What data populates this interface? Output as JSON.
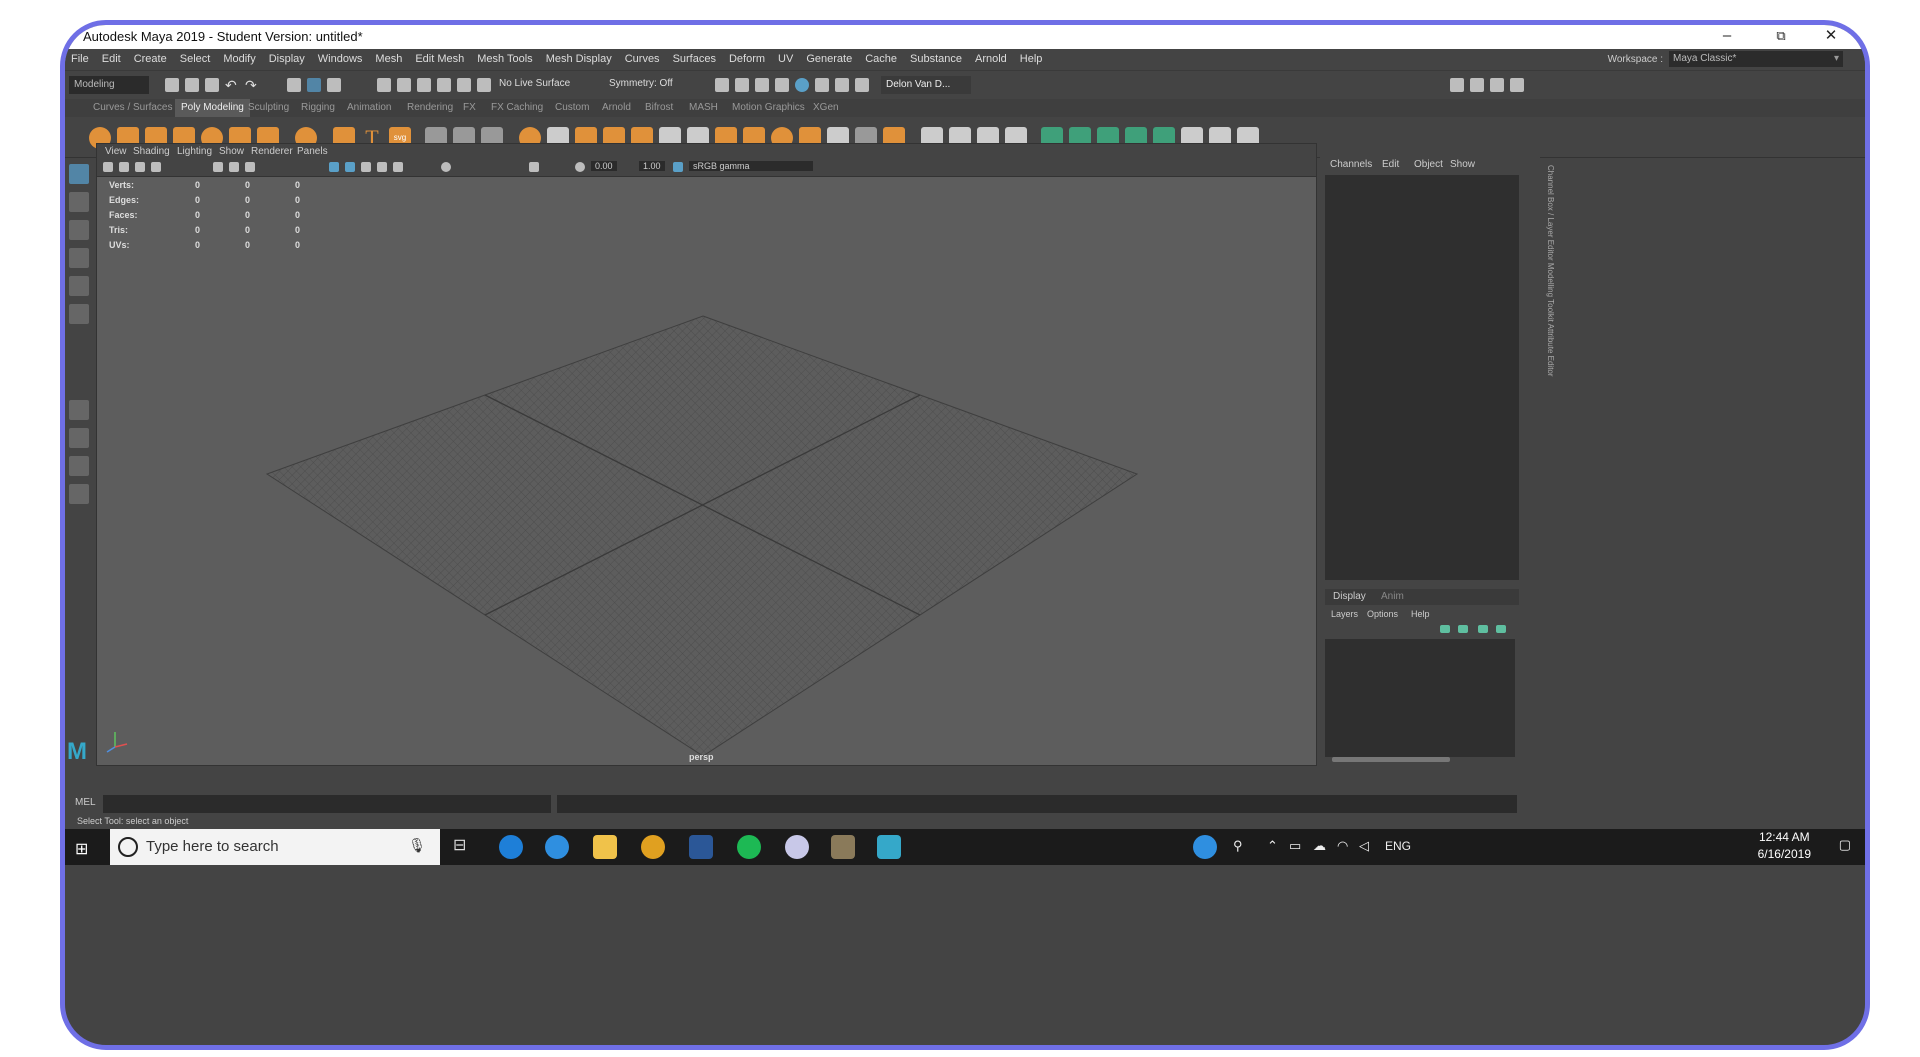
{
  "window": {
    "title": "Autodesk Maya 2019 - Student Version: untitled*",
    "minimize": "–",
    "restore": "⧉",
    "close": "✕"
  },
  "menubar": {
    "items": [
      "File",
      "Edit",
      "Create",
      "Select",
      "Modify",
      "Display",
      "Windows",
      "Mesh",
      "Edit Mesh",
      "Mesh Tools",
      "Mesh Display",
      "Curves",
      "Surfaces",
      "Deform",
      "UV",
      "Generate",
      "Cache",
      "Substance",
      "Arnold",
      "Help"
    ],
    "workspace_label": "Workspace :",
    "workspace_value": "Maya Classic*"
  },
  "statusline": {
    "menuset": "Modeling",
    "live_surface": "No Live Surface",
    "symmetry": "Symmetry: Off",
    "account": "Delon Van D..."
  },
  "shelf": {
    "tabs": [
      "Curves / Surfaces",
      "Poly Modeling",
      "Sculpting",
      "Rigging",
      "Animation",
      "Rendering",
      "FX",
      "FX Caching",
      "Custom",
      "Arnold",
      "Bifrost",
      "MASH",
      "Motion Graphics",
      "XGen"
    ],
    "active_tab": "Poly Modeling",
    "text_tool_label": "T",
    "svg_tool_label": "svg"
  },
  "viewport": {
    "menus": [
      "View",
      "Shading",
      "Lighting",
      "Show",
      "Renderer",
      "Panels"
    ],
    "exposure": "0.00",
    "gamma": "1.00",
    "color_space": "sRGB gamma",
    "camera_label": "persp",
    "hud": [
      {
        "label": "Verts:",
        "v1": "0",
        "v2": "0",
        "v3": "0"
      },
      {
        "label": "Edges:",
        "v1": "0",
        "v2": "0",
        "v3": "0"
      },
      {
        "label": "Faces:",
        "v1": "0",
        "v2": "0",
        "v3": "0"
      },
      {
        "label": "Tris:",
        "v1": "0",
        "v2": "0",
        "v3": "0"
      },
      {
        "label": "UVs:",
        "v1": "0",
        "v2": "0",
        "v3": "0"
      }
    ]
  },
  "channel_box": {
    "menus": [
      "Channels",
      "Edit",
      "Object",
      "Show"
    ],
    "side_tabs": "Channel Box / Layer Editor   Modelling Toolkit   Attribute Editor"
  },
  "layer_editor": {
    "tabs": [
      "Display",
      "Anim"
    ],
    "menus": [
      "Layers",
      "Options",
      "Help"
    ]
  },
  "command_line": {
    "label": "MEL",
    "help_text": "Select Tool: select an object"
  },
  "taskbar": {
    "search_placeholder": "Type here to search",
    "language": "ENG",
    "time": "12:44 AM",
    "date": "6/16/2019"
  },
  "colors": {
    "frame_border": "#6f6fe6",
    "maya_panel": "#444444",
    "viewport_bg": "#5d5d5d",
    "shelf_orange": "#e0913a",
    "shelf_green": "#3fa07a",
    "active_tool_blue": "#5285a6"
  }
}
